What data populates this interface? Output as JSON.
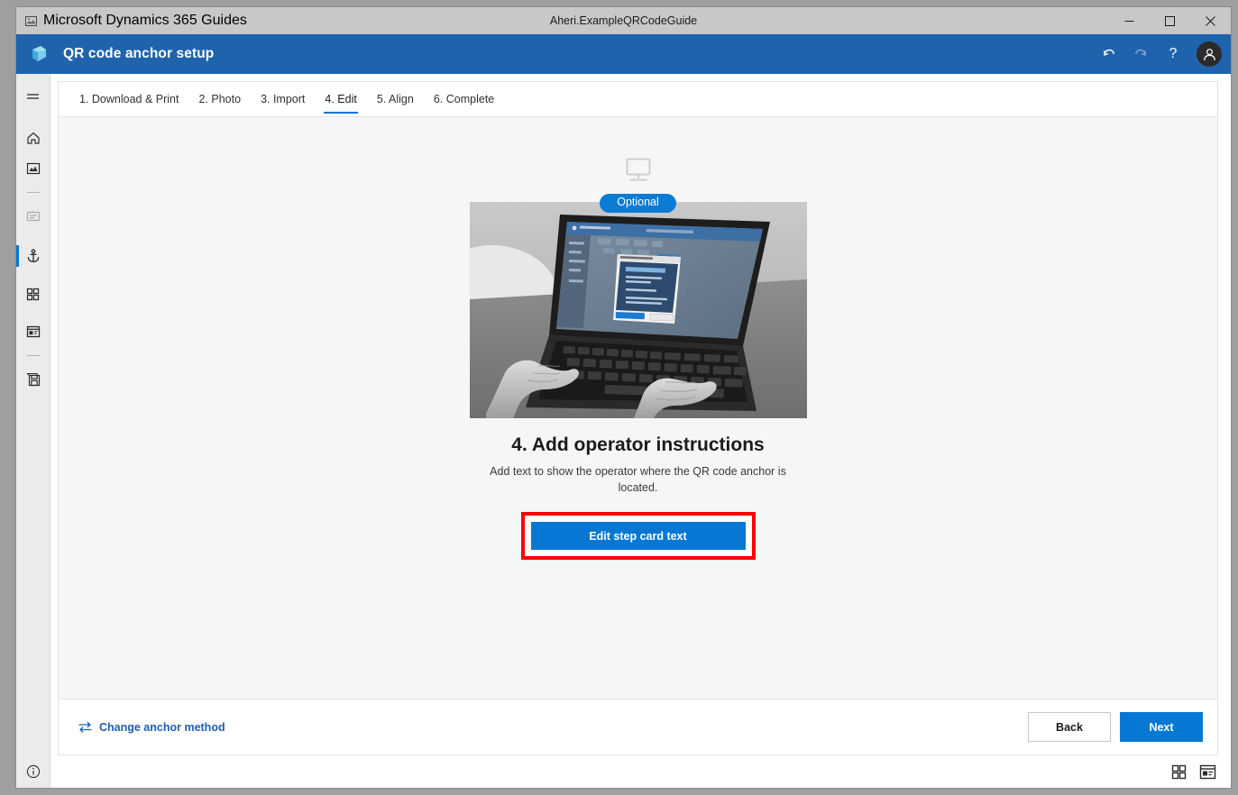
{
  "window": {
    "app_name": "Microsoft Dynamics 365 Guides",
    "document_title": "Aheri.ExampleQRCodeGuide",
    "app_icon": "app-window-icon",
    "controls": {
      "minimize": "─",
      "maximize": "❐",
      "close": "✕"
    }
  },
  "header": {
    "title": "QR code anchor setup",
    "logo": "dynamics-guides-logo",
    "actions": [
      {
        "name": "undo-button",
        "glyph": "↶",
        "enabled": true
      },
      {
        "name": "redo-button",
        "glyph": "↷",
        "enabled": false
      },
      {
        "name": "help-button",
        "glyph": "?",
        "enabled": true
      }
    ],
    "avatar": "account-avatar"
  },
  "rail": {
    "items": [
      {
        "name": "hamburger-menu-icon",
        "type": "menu",
        "state": "normal"
      },
      {
        "name": "home-icon",
        "type": "home",
        "state": "normal"
      },
      {
        "name": "media-gallery-icon",
        "type": "gallery",
        "state": "normal"
      },
      {
        "name": "rail-divider-1",
        "type": "divider",
        "state": "normal"
      },
      {
        "name": "step-card-icon",
        "type": "card",
        "state": "faded"
      },
      {
        "name": "anchor-icon",
        "type": "anchor",
        "state": "active"
      },
      {
        "name": "grid-view-icon",
        "type": "grid",
        "state": "normal"
      },
      {
        "name": "step-editor-icon",
        "type": "editor",
        "state": "normal"
      },
      {
        "name": "rail-divider-2",
        "type": "divider",
        "state": "normal"
      },
      {
        "name": "save-icon",
        "type": "save",
        "state": "normal"
      }
    ]
  },
  "tabs": [
    {
      "label": "1. Download & Print",
      "active": false
    },
    {
      "label": "2. Photo",
      "active": false
    },
    {
      "label": "3. Import",
      "active": false
    },
    {
      "label": "4. Edit",
      "active": true
    },
    {
      "label": "5. Align",
      "active": false
    },
    {
      "label": "6. Complete",
      "active": false
    }
  ],
  "main": {
    "optional_badge": "Optional",
    "monitor_icon": "desktop-monitor-icon",
    "photo_alt": "Hands typing on a laptop showing the QR code anchor dialog",
    "step_title": "4. Add operator instructions",
    "step_description": "Add text to show the operator where the QR code anchor is located.",
    "cta_label": "Edit step card text",
    "highlight_color": "#ff0000",
    "accent_color": "#0678d4"
  },
  "footer": {
    "change_anchor_label": "Change anchor method",
    "change_anchor_icon": "swap-arrows-icon",
    "back_label": "Back",
    "next_label": "Next"
  },
  "statusbar": {
    "info_icon": "info-circle-icon",
    "right_icons": [
      {
        "name": "grid-layout-icon"
      },
      {
        "name": "card-layout-icon"
      }
    ]
  }
}
